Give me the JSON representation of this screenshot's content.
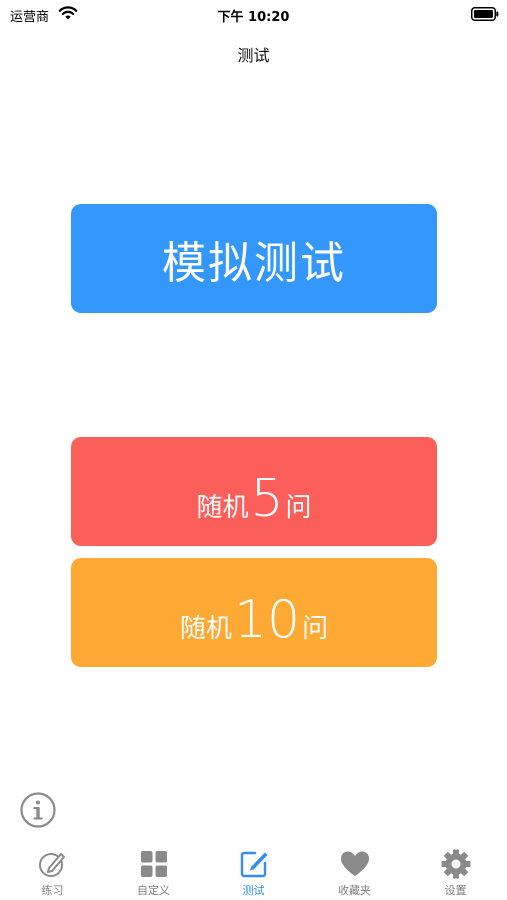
{
  "status_bar": {
    "carrier": "运营商",
    "time": "下午 10:20"
  },
  "nav": {
    "title": "测试"
  },
  "buttons": {
    "mock_test": "模拟测试",
    "random5": {
      "prefix": "随机",
      "number": "5",
      "suffix": "问"
    },
    "random10": {
      "prefix": "随机",
      "number": "10",
      "suffix": "问"
    }
  },
  "tabs": [
    {
      "label": "练习",
      "icon": "practice-pencil-icon",
      "active": false
    },
    {
      "label": "自定义",
      "icon": "grid-icon",
      "active": false
    },
    {
      "label": "测试",
      "icon": "edit-icon",
      "active": true
    },
    {
      "label": "收藏夹",
      "icon": "heart-icon",
      "active": false
    },
    {
      "label": "设置",
      "icon": "gear-icon",
      "active": false
    }
  ],
  "colors": {
    "mock_test": "#3497fb",
    "random5": "#fc5e5a",
    "random10": "#fea933",
    "tab_active": "#2f8ff0",
    "tab_inactive": "#7f7f7f"
  }
}
